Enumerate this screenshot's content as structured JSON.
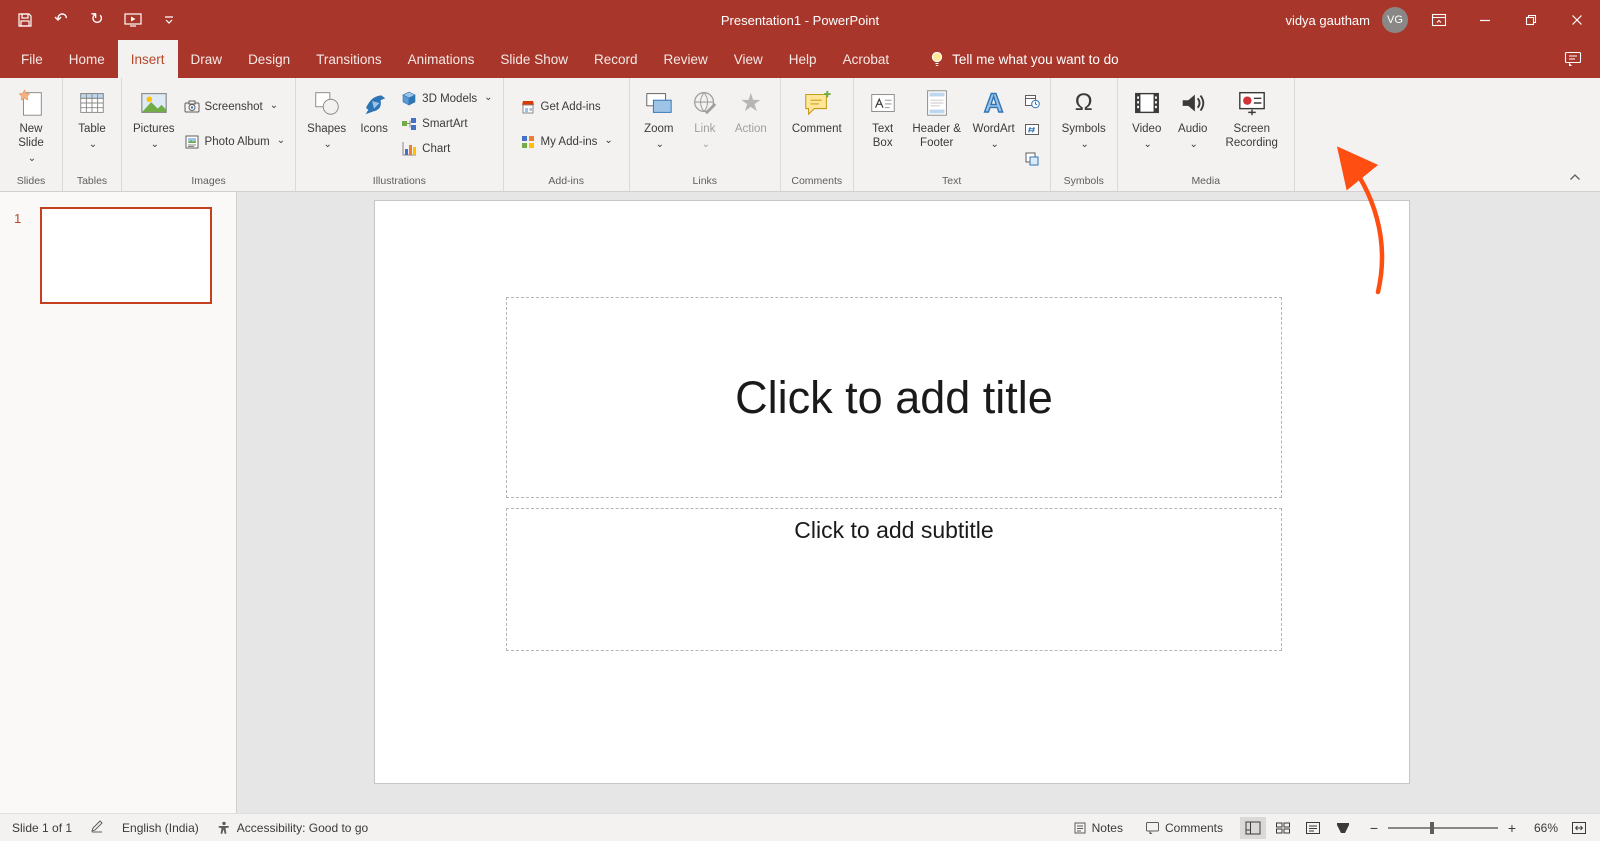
{
  "titlebar": {
    "title": "Presentation1 - PowerPoint",
    "user_name": "vidya gautham",
    "user_initials": "VG"
  },
  "menubar": {
    "tabs": [
      "File",
      "Home",
      "Insert",
      "Draw",
      "Design",
      "Transitions",
      "Animations",
      "Slide Show",
      "Record",
      "Review",
      "View",
      "Help",
      "Acrobat"
    ],
    "active_tab": "Insert",
    "tell_me": "Tell me what you want to do"
  },
  "ribbon": {
    "groups": [
      {
        "label": "Slides",
        "buttons": [
          {
            "label": "New Slide",
            "dropdown": true
          }
        ]
      },
      {
        "label": "Tables",
        "buttons": [
          {
            "label": "Table",
            "dropdown": true
          }
        ]
      },
      {
        "label": "Images",
        "buttons": [
          {
            "label": "Pictures",
            "dropdown": true
          },
          {
            "label": "Screenshot",
            "dropdown": true
          },
          {
            "label": "Photo Album",
            "dropdown": true
          }
        ]
      },
      {
        "label": "Illustrations",
        "buttons": [
          {
            "label": "Shapes",
            "dropdown": true
          },
          {
            "label": "Icons"
          },
          {
            "label": "3D Models",
            "dropdown": true
          },
          {
            "label": "SmartArt"
          },
          {
            "label": "Chart"
          }
        ]
      },
      {
        "label": "Add-ins",
        "buttons": [
          {
            "label": "Get Add-ins"
          },
          {
            "label": "My Add-ins",
            "dropdown": true
          }
        ]
      },
      {
        "label": "Links",
        "buttons": [
          {
            "label": "Zoom",
            "dropdown": true
          },
          {
            "label": "Link",
            "dropdown": true,
            "disabled": true
          },
          {
            "label": "Action",
            "disabled": true
          }
        ]
      },
      {
        "label": "Comments",
        "buttons": [
          {
            "label": "Comment"
          }
        ]
      },
      {
        "label": "Text",
        "buttons": [
          {
            "label": "Text Box"
          },
          {
            "label": "Header & Footer"
          },
          {
            "label": "WordArt",
            "dropdown": true
          }
        ]
      },
      {
        "label": "Symbols",
        "buttons": [
          {
            "label": "Symbols",
            "dropdown": true
          }
        ]
      },
      {
        "label": "Media",
        "buttons": [
          {
            "label": "Video",
            "dropdown": true
          },
          {
            "label": "Audio",
            "dropdown": true
          },
          {
            "label": "Screen Recording"
          }
        ]
      }
    ]
  },
  "slide_panel": {
    "slide_number": "1"
  },
  "slide": {
    "title_placeholder": "Click to add title",
    "subtitle_placeholder": "Click to add subtitle"
  },
  "statusbar": {
    "slide_indicator": "Slide 1 of 1",
    "language": "English (India)",
    "accessibility": "Accessibility: Good to go",
    "notes_label": "Notes",
    "comments_label": "Comments",
    "zoom_level": "66%"
  },
  "icons": {
    "undo": "↶",
    "redo": "↻",
    "omega": "Ω",
    "wordart_letter": "A",
    "action_star": "★",
    "zoom_minus": "−",
    "zoom_plus": "+"
  },
  "colors": {
    "titlebar_red": "#A8362B",
    "accent_red": "#B7472A",
    "annotation_arrow": "#FF4E11",
    "selected_slide_border": "#C4401F"
  },
  "annotation": {
    "type": "arrow",
    "points_to": "Video"
  }
}
